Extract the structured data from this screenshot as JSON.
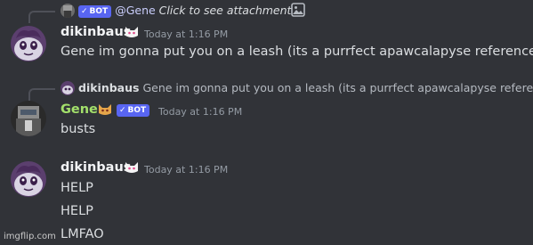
{
  "reply_1": {
    "author": "Gene",
    "bot_label": "BOT",
    "mention": "@Gene",
    "text": "Click to see attachment"
  },
  "message_1": {
    "author": "dikinbaus",
    "timestamp": "Today at 1:16 PM",
    "text": "Gene im gonna put you on a leash (its a purrfect apawcalapyse reference)"
  },
  "reply_2": {
    "author": "dikinbaus",
    "text": "Gene im gonna put you on a leash (its a purrfect apawcalapyse reference)"
  },
  "message_2": {
    "author": "Gene",
    "bot_label": "BOT",
    "timestamp": "Today at 1:16 PM",
    "text": "busts"
  },
  "message_3": {
    "author": "dikinbaus",
    "timestamp": "Today at 1:16 PM",
    "lines": [
      "HELP",
      "HELP",
      "LMFAO"
    ]
  },
  "watermark": "imgflip.com",
  "colors": {
    "background": "#313338",
    "username_default": "#f2f3f5",
    "username_gene": "#a3e06b",
    "bot_tag": "#5865f2",
    "text": "#dbdee1",
    "timestamp": "#949ba4"
  }
}
